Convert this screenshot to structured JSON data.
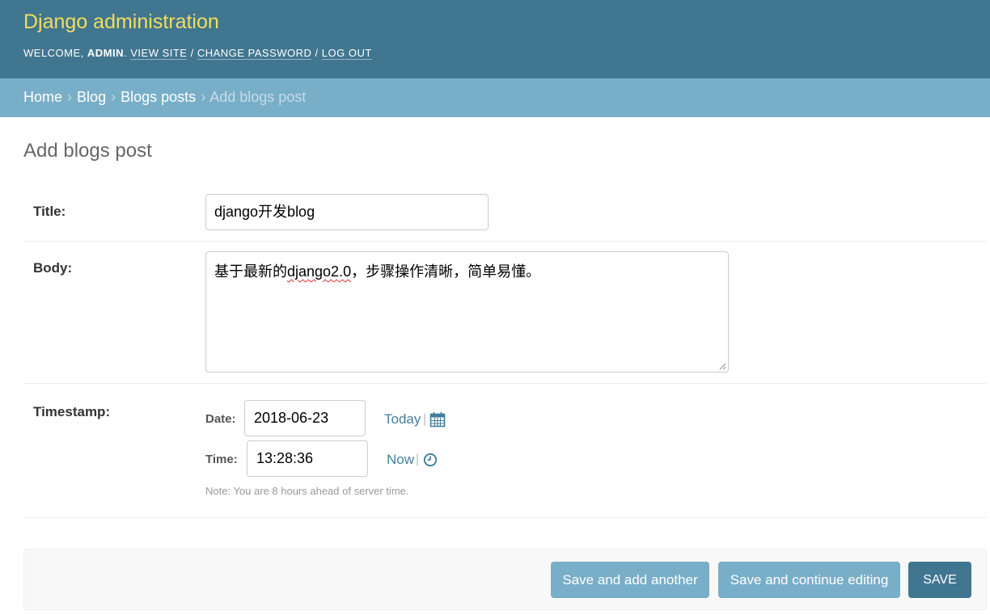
{
  "header": {
    "branding": "Django administration",
    "welcome_prefix": "Welcome, ",
    "username": "admin",
    "welcome_suffix": ". ",
    "view_site": "View site",
    "change_password": "Change password",
    "log_out": "Log out",
    "separator": " / "
  },
  "breadcrumbs": {
    "items": [
      "Home",
      "Blog",
      "Blogs posts"
    ],
    "current": "Add blogs post",
    "separator": "›"
  },
  "page_title": "Add blogs post",
  "form": {
    "title": {
      "label": "Title:",
      "value": "django开发blog"
    },
    "body": {
      "label": "Body:",
      "value_before": "基于最新的",
      "value_misspelled": "django2.0",
      "value_after": "，步骤操作清晰，简单易懂。"
    },
    "timestamp": {
      "label": "Timestamp:",
      "date_label": "Date:",
      "date_value": "2018-06-23",
      "today_link": "Today",
      "time_label": "Time:",
      "time_value": "13:28:36",
      "now_link": "Now",
      "pipe": "|",
      "help_text": "Note: You are 8 hours ahead of server time."
    }
  },
  "submit_row": {
    "save_add_another": "Save and add another",
    "save_continue": "Save and continue editing",
    "save": "Save"
  },
  "colors": {
    "header_bg": "#417690",
    "branding": "#f5dd5d",
    "breadcrumb_bg": "#79aec8",
    "link": "#447e9b",
    "button": "#79aec8",
    "button_default": "#417690"
  }
}
